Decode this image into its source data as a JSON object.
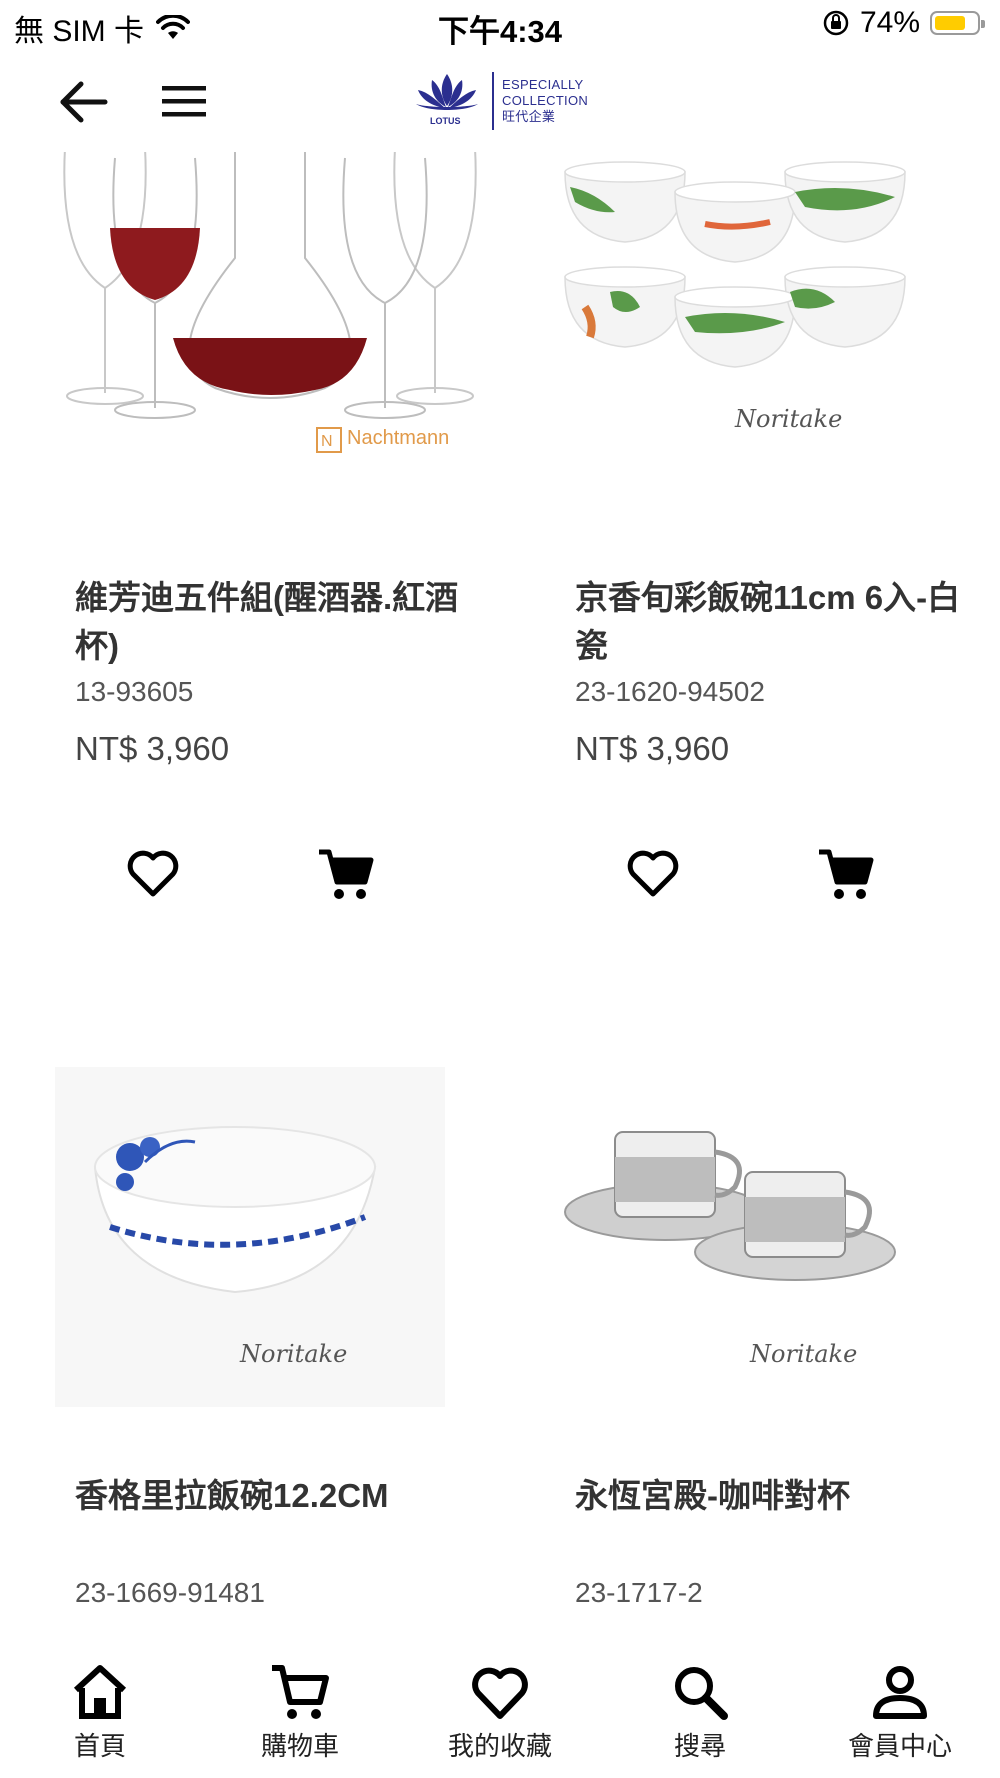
{
  "status_bar": {
    "carrier": "無 SIM 卡",
    "time": "下午4:34",
    "battery_percent": "74%",
    "battery_level": 0.74,
    "battery_color": "#ffcc00"
  },
  "header": {
    "logo_brand": "LOTUS",
    "logo_line1": "ESPECIALLY",
    "logo_line2": "COLLECTION",
    "logo_line3": "旺代企業",
    "logo_color": "#2b2f8f"
  },
  "products": [
    {
      "brand": "Nachtmann",
      "name": "維芳迪五件組(醒酒器.紅酒杯)",
      "code": "13-93605",
      "price": "NT$ 3,960"
    },
    {
      "brand": "Noritake",
      "name": "京香旬彩飯碗11cm 6入-白瓷",
      "code": "23-1620-94502",
      "price": "NT$ 3,960"
    },
    {
      "brand": "Noritake",
      "name": "香格里拉飯碗12.2CM",
      "code": "23-1669-91481",
      "price": ""
    },
    {
      "brand": "Noritake",
      "name": "永恆宮殿-咖啡對杯",
      "code": "23-1717-2",
      "price": ""
    }
  ],
  "bottom_nav": [
    {
      "label": "首頁",
      "icon": "home-icon"
    },
    {
      "label": "購物車",
      "icon": "cart-icon"
    },
    {
      "label": "我的收藏",
      "icon": "heart-icon"
    },
    {
      "label": "搜尋",
      "icon": "search-icon"
    },
    {
      "label": "會員中心",
      "icon": "person-icon"
    }
  ]
}
